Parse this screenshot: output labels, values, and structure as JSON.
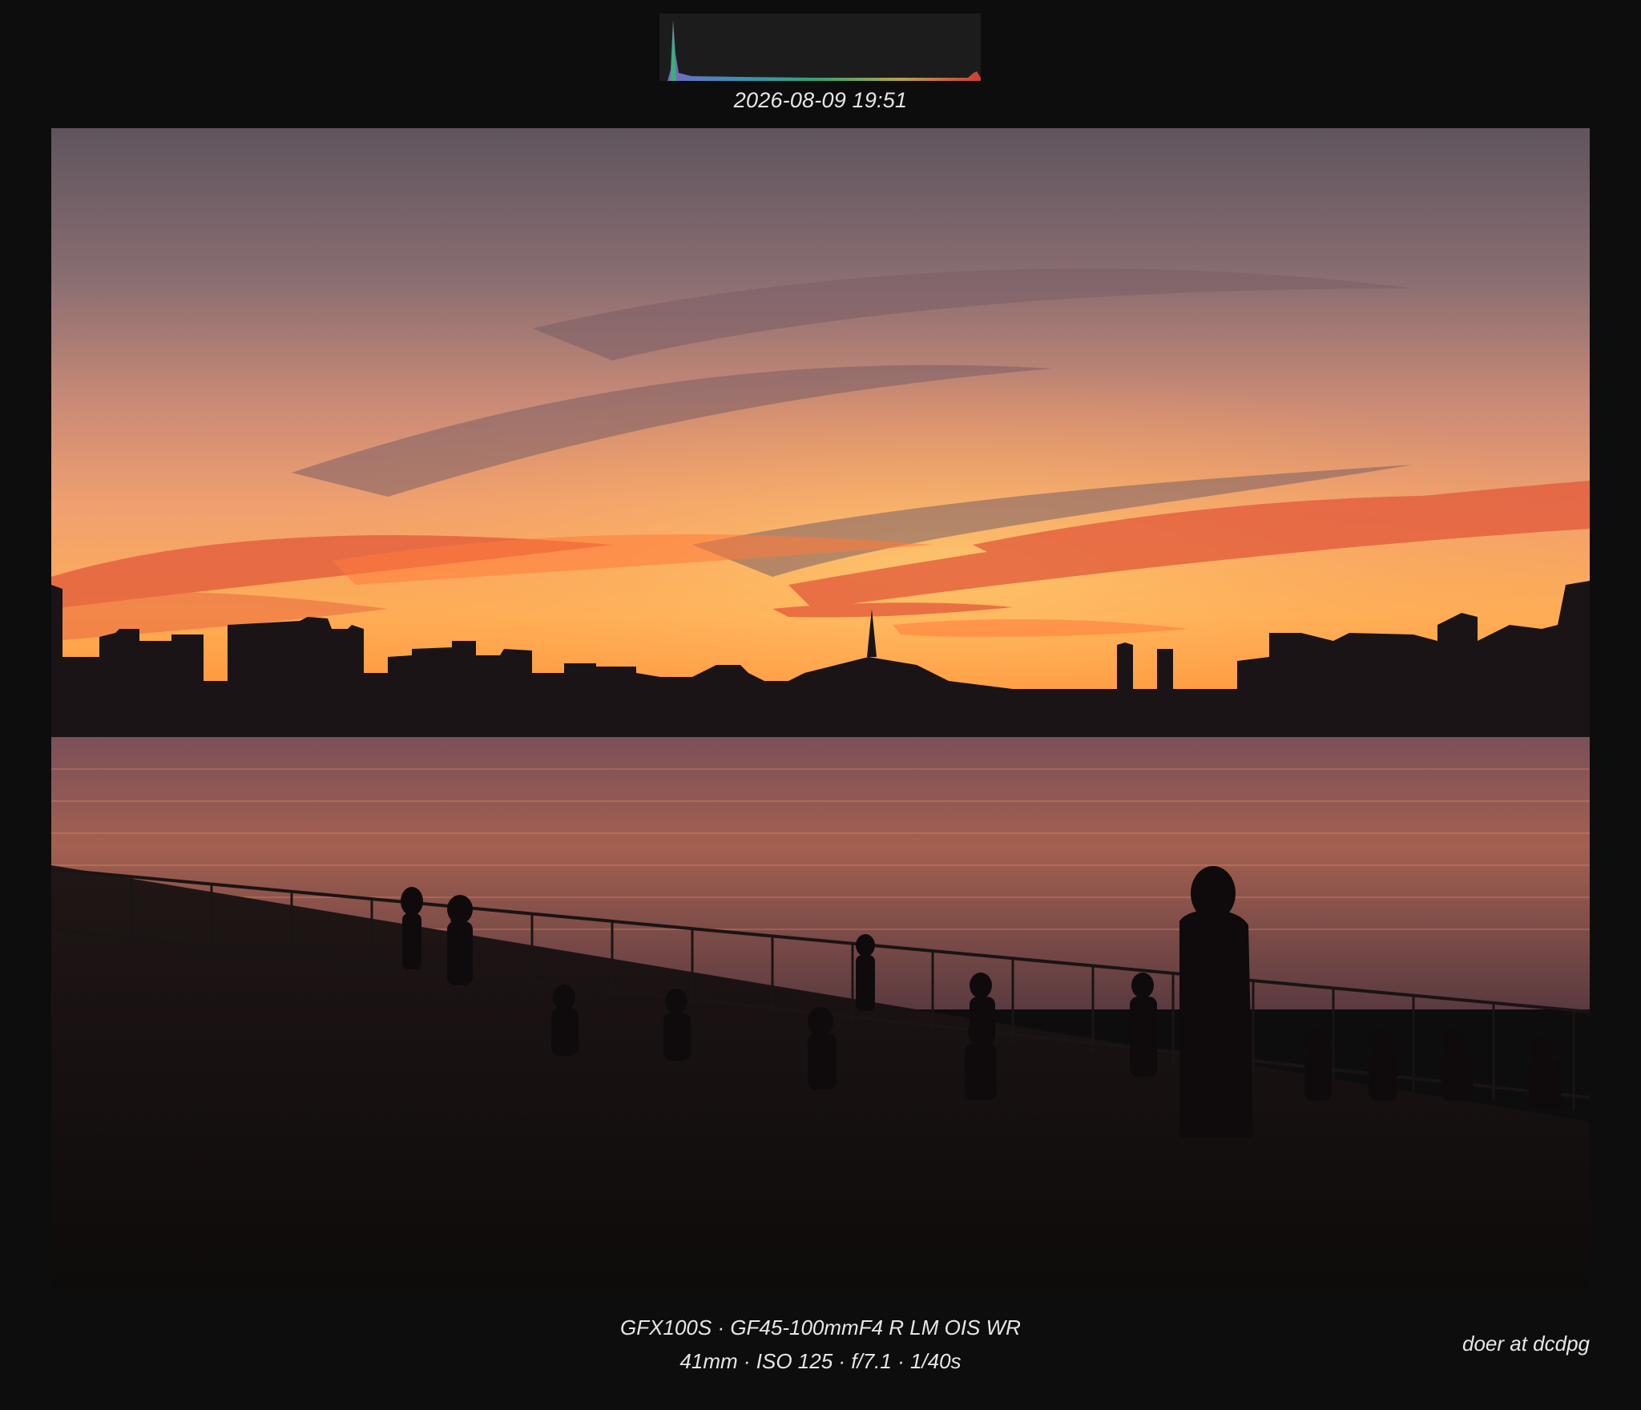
{
  "timestamp": "2026-08-09 19:51",
  "camera": {
    "line1": "GFX100S · GF45-100mmF4 R LM OIS WR",
    "line2": "41mm · ISO 125 · f/7.1 · 1/40s"
  },
  "credit": "doer at dcdpg",
  "colors": {
    "background": "#0d0d0d",
    "text": "#e6e6e6",
    "sky_top": "#6e5a60",
    "sky_glow": "#ff8a3a",
    "water": "#a46050"
  }
}
